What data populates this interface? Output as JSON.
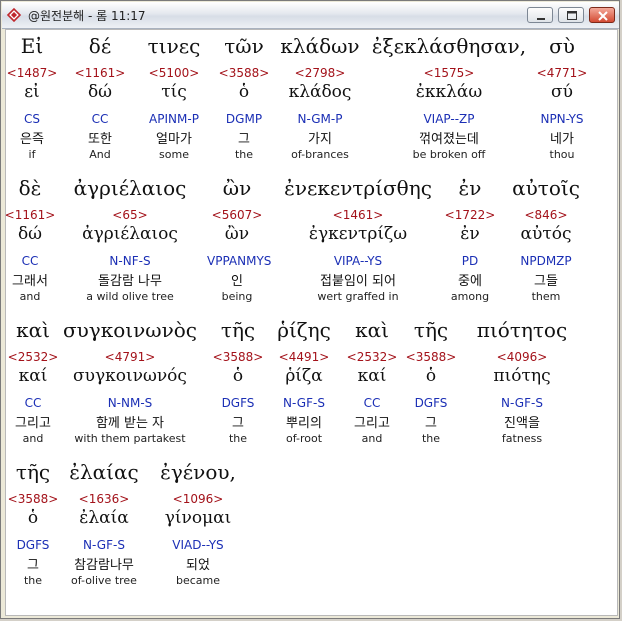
{
  "window": {
    "title": "@원전분해 - 롬 11:17",
    "buttons": {
      "minimize": "minimize-icon",
      "maximize": "maximize-icon",
      "close": "close-icon"
    }
  },
  "rows": [
    {
      "words": [
        {
          "greek": "Εἰ",
          "strong": "<1487>",
          "lemma": "εἰ",
          "parse": "CS",
          "korean": "은즉",
          "english": "if"
        },
        {
          "greek": "δέ",
          "strong": "<1161>",
          "lemma": "δώ",
          "parse": "CC",
          "korean": "또한",
          "english": "And"
        },
        {
          "greek": "τινες",
          "strong": "<5100>",
          "lemma": "τίς",
          "parse": "APINM-P",
          "korean": "얼마가",
          "english": "some"
        },
        {
          "greek": "τῶν",
          "strong": "<3588>",
          "lemma": "ὁ",
          "parse": "DGMP",
          "korean": "그",
          "english": "the"
        },
        {
          "greek": "κλάδων",
          "strong": "<2798>",
          "lemma": "κλάδος",
          "parse": "N-GM-P",
          "korean": "가지",
          "english": "of-brances"
        },
        {
          "greek": "ἐξεκλάσθησαν,",
          "strong": "<1575>",
          "lemma": "ἐκκλάω",
          "parse": "VIAP--ZP",
          "korean": "꺾여졌는데",
          "english": "be broken off"
        },
        {
          "greek": "σὺ",
          "strong": "<4771>",
          "lemma": "σύ",
          "parse": "NPN-YS",
          "korean": "네가",
          "english": "thou"
        }
      ]
    },
    {
      "words": [
        {
          "greek": "δὲ",
          "strong": "<1161>",
          "lemma": "δώ",
          "parse": "CC",
          "korean": "그래서",
          "english": "and"
        },
        {
          "greek": "ἀγριέλαιος",
          "strong": "<65>",
          "lemma": "ἀγριέλαιος",
          "parse": "N-NF-S",
          "korean": "돌감람 나무",
          "english": "a wild olive tree"
        },
        {
          "greek": "ὢν",
          "strong": "<5607>",
          "lemma": "ὢν",
          "parse": "VPPANMYS",
          "korean": "인",
          "english": "being"
        },
        {
          "greek": "ἐνεκεντρίσθης",
          "strong": "<1461>",
          "lemma": "ἐγκεντρίζω",
          "parse": "VIPA--YS",
          "korean": "접붙임이 되어",
          "english": "wert graffed in"
        },
        {
          "greek": "ἐν",
          "strong": "<1722>",
          "lemma": "ἐν",
          "parse": "PD",
          "korean": "중에",
          "english": "among"
        },
        {
          "greek": "αὐτοῖς",
          "strong": "<846>",
          "lemma": "αὐτός",
          "parse": "NPDMZP",
          "korean": "그들",
          "english": "them"
        }
      ]
    },
    {
      "words": [
        {
          "greek": "καὶ",
          "strong": "<2532>",
          "lemma": "καί",
          "parse": "CC",
          "korean": "그리고",
          "english": "and"
        },
        {
          "greek": "συγκοινωνὸς",
          "strong": "<4791>",
          "lemma": "συγκοινωνός",
          "parse": "N-NM-S",
          "korean": "함께 받는 자",
          "english": "with them partakest"
        },
        {
          "greek": "τῆς",
          "strong": "<3588>",
          "lemma": "ὁ",
          "parse": "DGFS",
          "korean": "그",
          "english": "the"
        },
        {
          "greek": "ῥίζης",
          "strong": "<4491>",
          "lemma": "ῥίζα",
          "parse": "N-GF-S",
          "korean": "뿌리의",
          "english": "of-root"
        },
        {
          "greek": "καὶ",
          "strong": "<2532>",
          "lemma": "καί",
          "parse": "CC",
          "korean": "그리고",
          "english": "and"
        },
        {
          "greek": "τῆς",
          "strong": "<3588>",
          "lemma": "ὁ",
          "parse": "DGFS",
          "korean": "그",
          "english": "the"
        },
        {
          "greek": "πιότητος",
          "strong": "<4096>",
          "lemma": "πιότης",
          "parse": "N-GF-S",
          "korean": "진액을",
          "english": "fatness"
        }
      ]
    },
    {
      "words": [
        {
          "greek": "τῆς",
          "strong": "<3588>",
          "lemma": "ὁ",
          "parse": "DGFS",
          "korean": "그",
          "english": "the"
        },
        {
          "greek": "ἐλαίας",
          "strong": "<1636>",
          "lemma": "ἐλαία",
          "parse": "N-GF-S",
          "korean": "참감람나무",
          "english": "of-olive tree"
        },
        {
          "greek": "ἐγένου,",
          "strong": "<1096>",
          "lemma": "γίνομαι",
          "parse": "VIAD--YS",
          "korean": "되었",
          "english": "became"
        }
      ]
    }
  ],
  "colors": {
    "strong_number": "#a3121a",
    "parsing": "#1b2fb5",
    "text": "#111111"
  }
}
